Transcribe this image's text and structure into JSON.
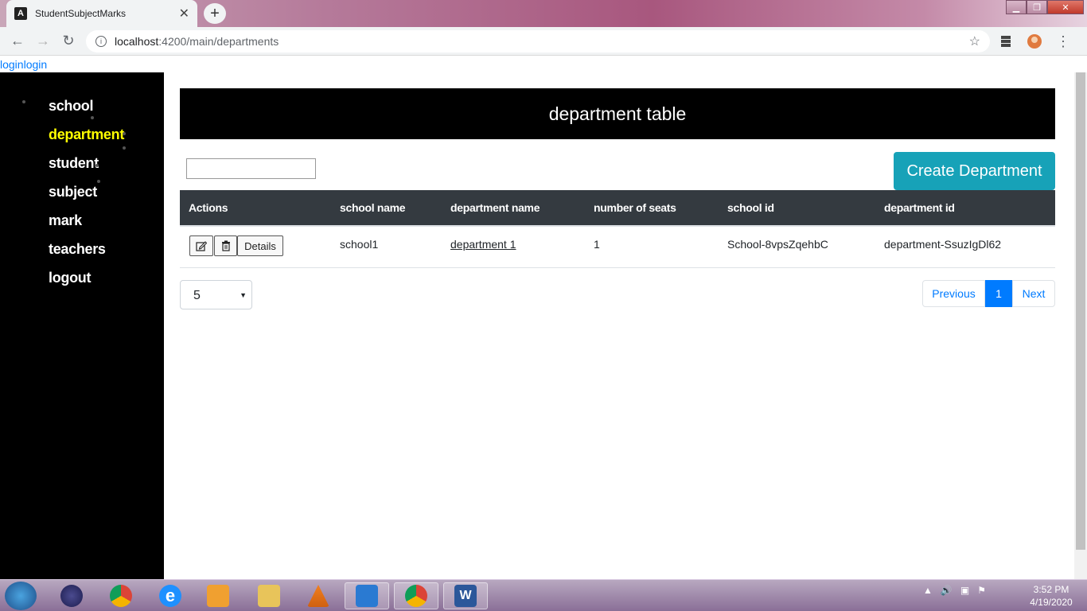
{
  "browser": {
    "tab_title": "StudentSubjectMarks",
    "tab_favicon": "A",
    "url_host": "localhost",
    "url_rest": ":4200/main/departments"
  },
  "page": {
    "login_link": "loginlogin",
    "sidebar": {
      "items": [
        {
          "label": "school"
        },
        {
          "label": "department"
        },
        {
          "label": "student"
        },
        {
          "label": "subject"
        },
        {
          "label": "mark"
        },
        {
          "label": "teachers"
        },
        {
          "label": "logout"
        }
      ],
      "active_index": 1,
      "active_color": "#ffff00"
    },
    "header_title": "department table",
    "search_value": "",
    "create_button": "Create Department",
    "table": {
      "columns": [
        "Actions",
        "school name",
        "department name",
        "number of seats",
        "school id",
        "department id"
      ],
      "rows": [
        {
          "details_label": "Details",
          "school_name": "school1",
          "department_name": "department 1",
          "number_of_seats": "1",
          "school_id": "School-8vpsZqehbC",
          "department_id": "department-SsuzIgDl62"
        }
      ]
    },
    "page_size": "5",
    "pagination": {
      "previous": "Previous",
      "current": "1",
      "next": "Next"
    }
  },
  "taskbar": {
    "time": "3:52 PM",
    "date": "4/19/2020"
  },
  "colors": {
    "sidebar_bg": "#000000",
    "create_button_bg": "#17a2b8",
    "table_header_bg": "#343a40",
    "pagination_active": "#007bff"
  }
}
